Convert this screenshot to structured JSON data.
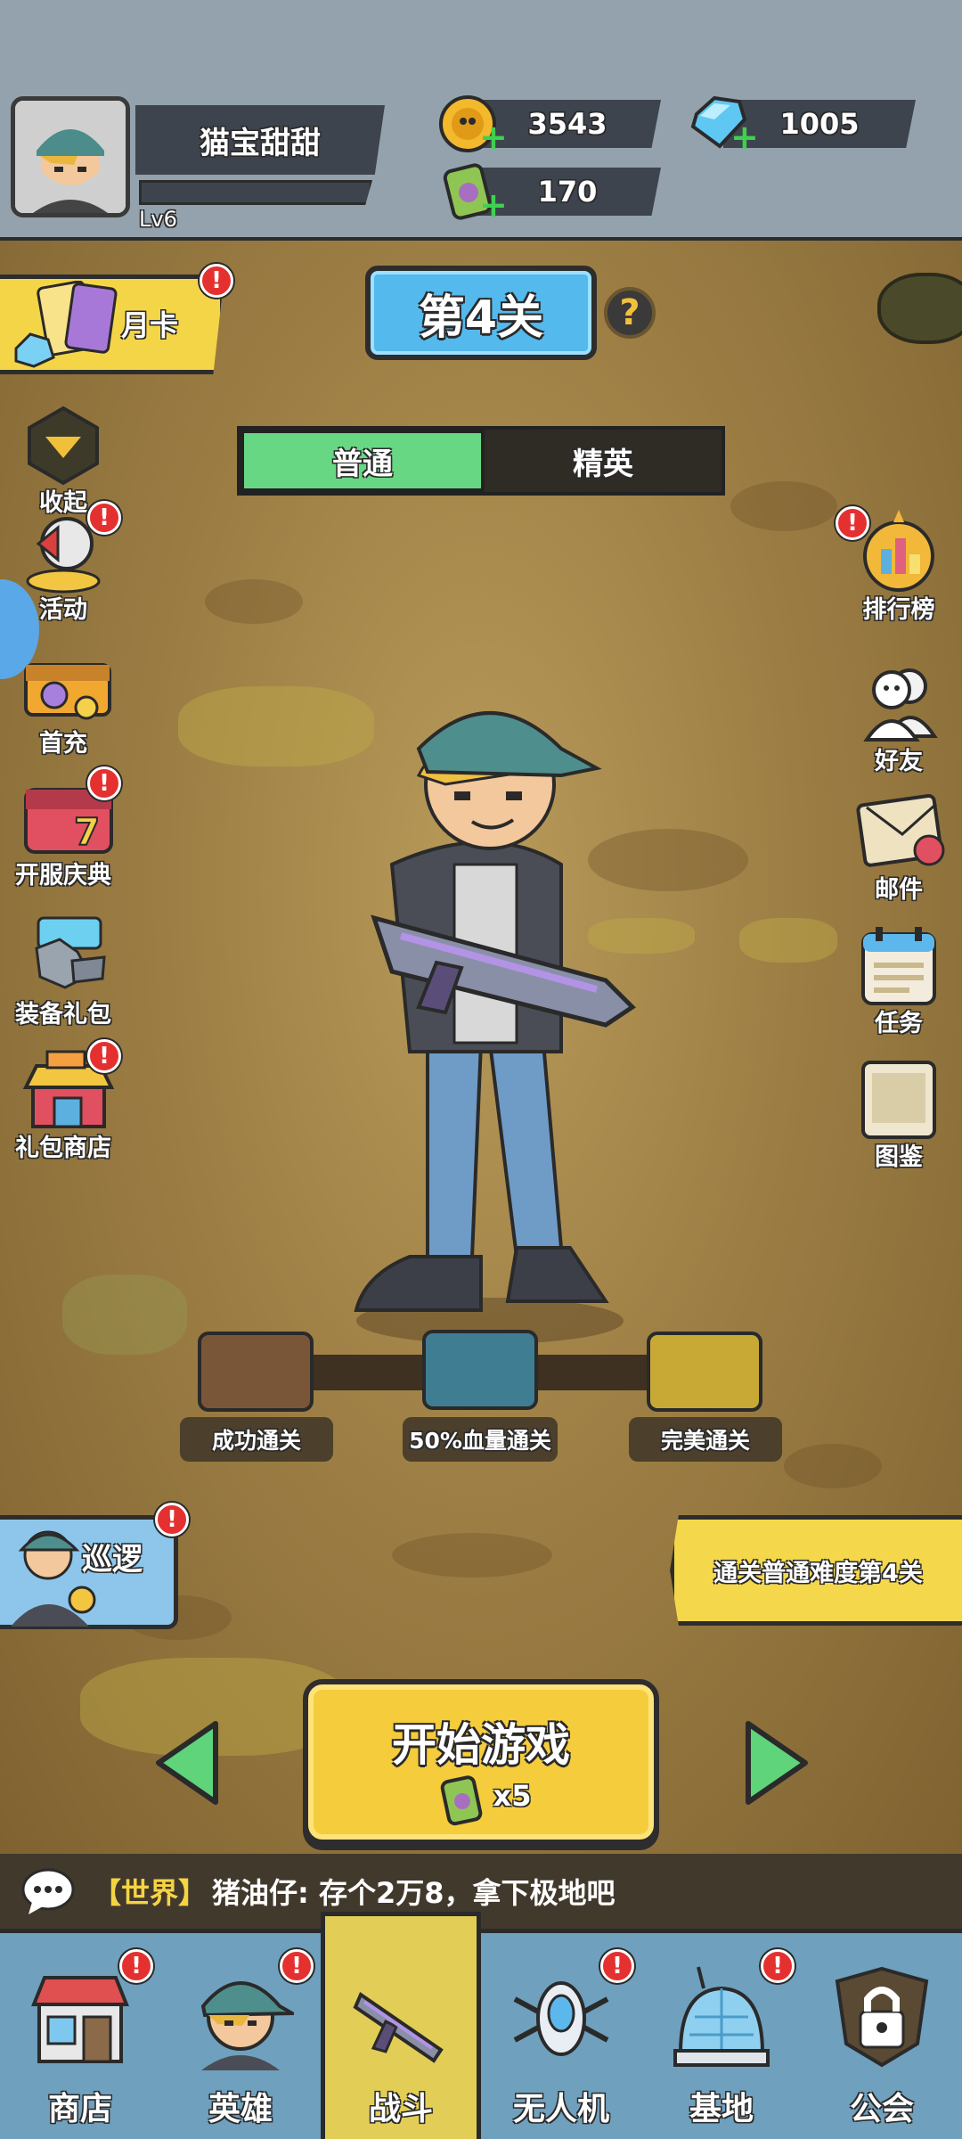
{
  "player": {
    "name": "猫宝甜甜",
    "level": "Lv6"
  },
  "resources": {
    "coins": "3543",
    "gems": "1005",
    "energy": "170"
  },
  "stage": {
    "title": "第4关",
    "help": "?"
  },
  "month_card": {
    "label": "月卡",
    "badge": "!"
  },
  "difficulty": {
    "tabs": [
      {
        "label": "普通",
        "active": true
      },
      {
        "label": "精英",
        "active": false
      }
    ]
  },
  "left_menu": [
    {
      "label": "收起"
    },
    {
      "label": "活动",
      "badge": "!"
    },
    {
      "label": "首充"
    },
    {
      "label": "开服庆典",
      "badge": "!"
    },
    {
      "label": "装备礼包"
    },
    {
      "label": "礼包商店",
      "badge": "!"
    }
  ],
  "right_menu": [
    {
      "label": "排行榜",
      "badge": "!"
    },
    {
      "label": "好友"
    },
    {
      "label": "邮件"
    },
    {
      "label": "任务"
    },
    {
      "label": "图鉴"
    }
  ],
  "chests": [
    {
      "label": "成功通关"
    },
    {
      "label": "50%血量通关"
    },
    {
      "label": "完美通关"
    }
  ],
  "patrol": {
    "label": "巡逻",
    "badge": "!"
  },
  "quest": {
    "text": "通关普通难度第4关"
  },
  "start": {
    "label": "开始游戏",
    "cost": "x5"
  },
  "chat": {
    "channel": "【世界】",
    "message": "猪油仔: 存个2万8，拿下极地吧"
  },
  "bottom_nav": [
    {
      "label": "商店",
      "badge": "!",
      "active": false
    },
    {
      "label": "英雄",
      "badge": "!",
      "active": false
    },
    {
      "label": "战斗",
      "active": true
    },
    {
      "label": "无人机",
      "badge": "!",
      "active": false
    },
    {
      "label": "基地",
      "badge": "!",
      "active": false
    },
    {
      "label": "公会",
      "active": false
    }
  ],
  "colors": {
    "header_bg": "#93a2ad",
    "ground": "#9d7f45",
    "accent_yellow": "#f5cc3b",
    "accent_blue": "#54b9ec",
    "tab_active": "#67d783",
    "badge_red": "#e53030"
  }
}
